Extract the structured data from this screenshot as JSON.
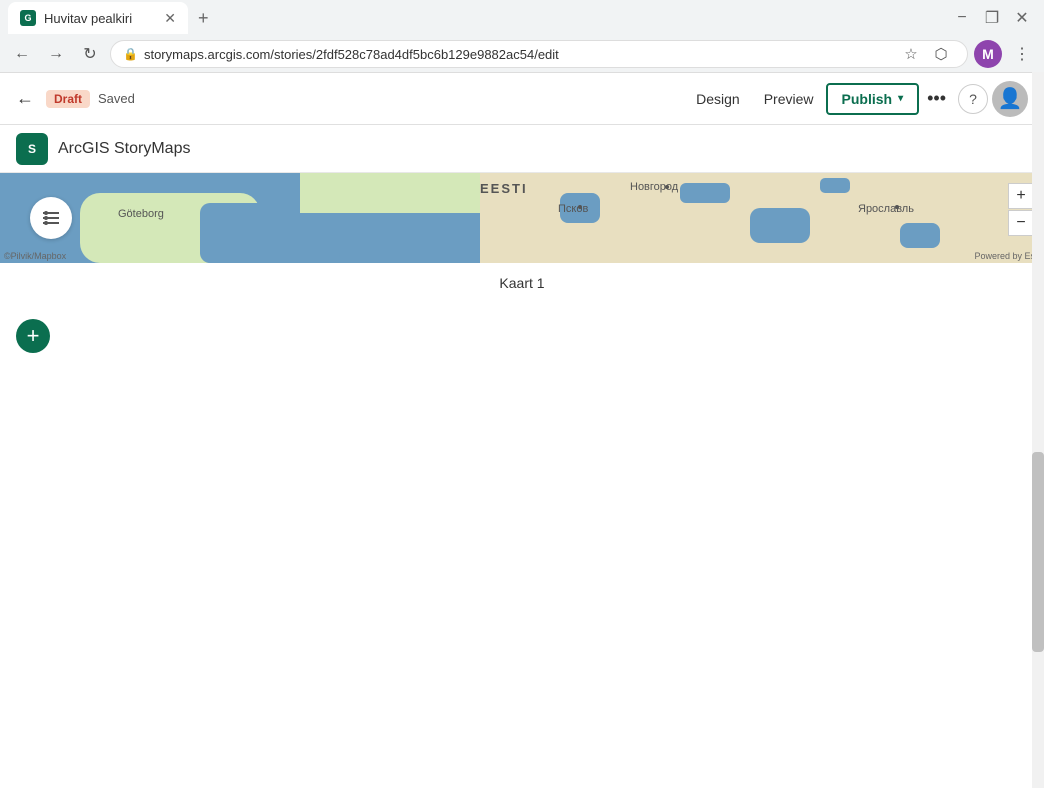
{
  "browser": {
    "tab_title": "Huvitav pealkiri",
    "url": "storymaps.arcgis.com/stories/2fdf528c78ad4df5bc6b129e9882ac54/edit",
    "new_tab_label": "+",
    "profile_letter": "M",
    "window_controls": {
      "minimize": "−",
      "maximize": "❐",
      "close": "✕"
    },
    "nav": {
      "back": "←",
      "forward": "→",
      "refresh": "↻"
    }
  },
  "app_header": {
    "back_label": "←",
    "draft_label": "Draft",
    "saved_label": "Saved",
    "design_label": "Design",
    "preview_label": "Preview",
    "publish_label": "Publish",
    "publish_chevron": "▾",
    "more_label": "•••",
    "help_label": "?",
    "brand_name": "ArcGIS StoryMaps"
  },
  "map": {
    "caption": "Kaart 1",
    "attribution_left": "©Pilvik/Mapbox",
    "attribution_right": "Powered by Esri",
    "labels": {
      "eesti": "EESTI",
      "novgorod": "Новгород",
      "pskov": "Псков",
      "yaroslavl": "Ярославль",
      "goteborg": "Göteborg"
    },
    "plus_label": "+",
    "minus_label": "−"
  },
  "content": {
    "add_block_icon": "+"
  }
}
